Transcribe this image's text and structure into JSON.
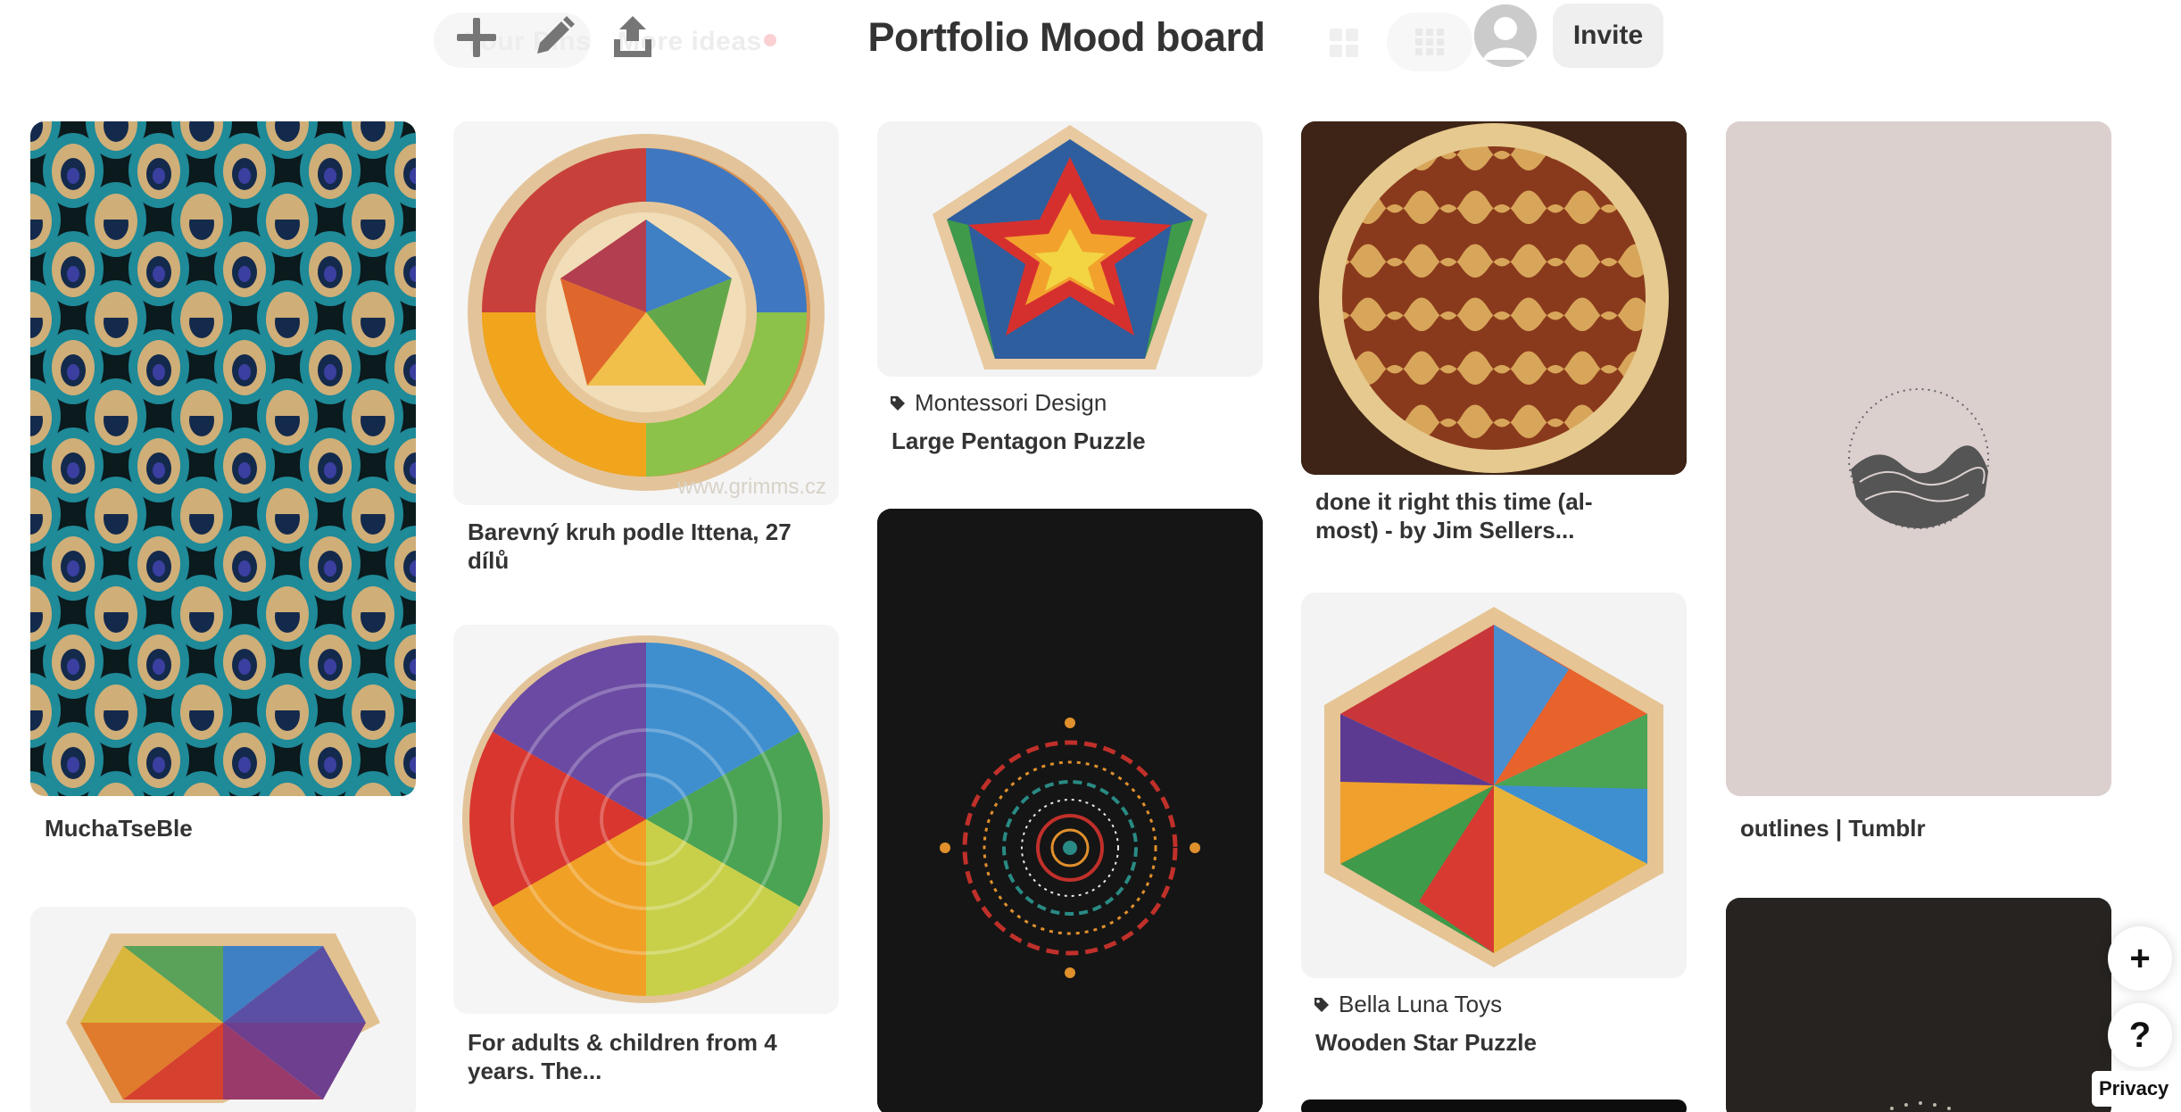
{
  "header": {
    "board_title": "Portfolio Mood board",
    "add_icon": "plus-icon",
    "edit_icon": "pencil-icon",
    "share_icon": "share-upload-icon",
    "ghost_tab_pins": "Your Pins",
    "ghost_tab_ideas": "More ideas",
    "view_icon": "grid-view-icon",
    "avatar_icon": "user-avatar-icon",
    "invite_label": "Invite"
  },
  "pins": [
    {
      "title": "MuchaTseBle",
      "source": "",
      "image": "peacock feather pattern"
    },
    {
      "title": "",
      "source": "",
      "image": "hexagon rainbow puzzle"
    },
    {
      "title": "Barevný kruh podle Ittena, 27 dílů",
      "source": "",
      "image": "wooden color circle",
      "watermark": "www.grimms.cz"
    },
    {
      "title": "For adults & children from 4 years. The...",
      "source": "",
      "image": "rainbow spiral circle"
    },
    {
      "title": "Large Pentagon Puzzle",
      "source": "Montessori Design",
      "image": "pentagon star puzzle"
    },
    {
      "title": "",
      "source": "",
      "image": "mandala on black"
    },
    {
      "title": "done it right this time (al- most) - by Jim Sellers...",
      "source": "",
      "image": "inlaid wood table"
    },
    {
      "title": "Wooden Star Puzzle",
      "source": "Bella Luna Toys",
      "image": "hexagon star puzzle"
    },
    {
      "title": "outlines | Tumblr",
      "source": "",
      "image": "wave circle sketch"
    },
    {
      "title": "",
      "source": "",
      "image": "dark card"
    }
  ],
  "floating": {
    "add_label": "+",
    "help_label": "?",
    "privacy_label": "Privacy"
  },
  "colors": {
    "text": "#333333",
    "pill": "#efefef",
    "accent_dot": "#e60023"
  }
}
